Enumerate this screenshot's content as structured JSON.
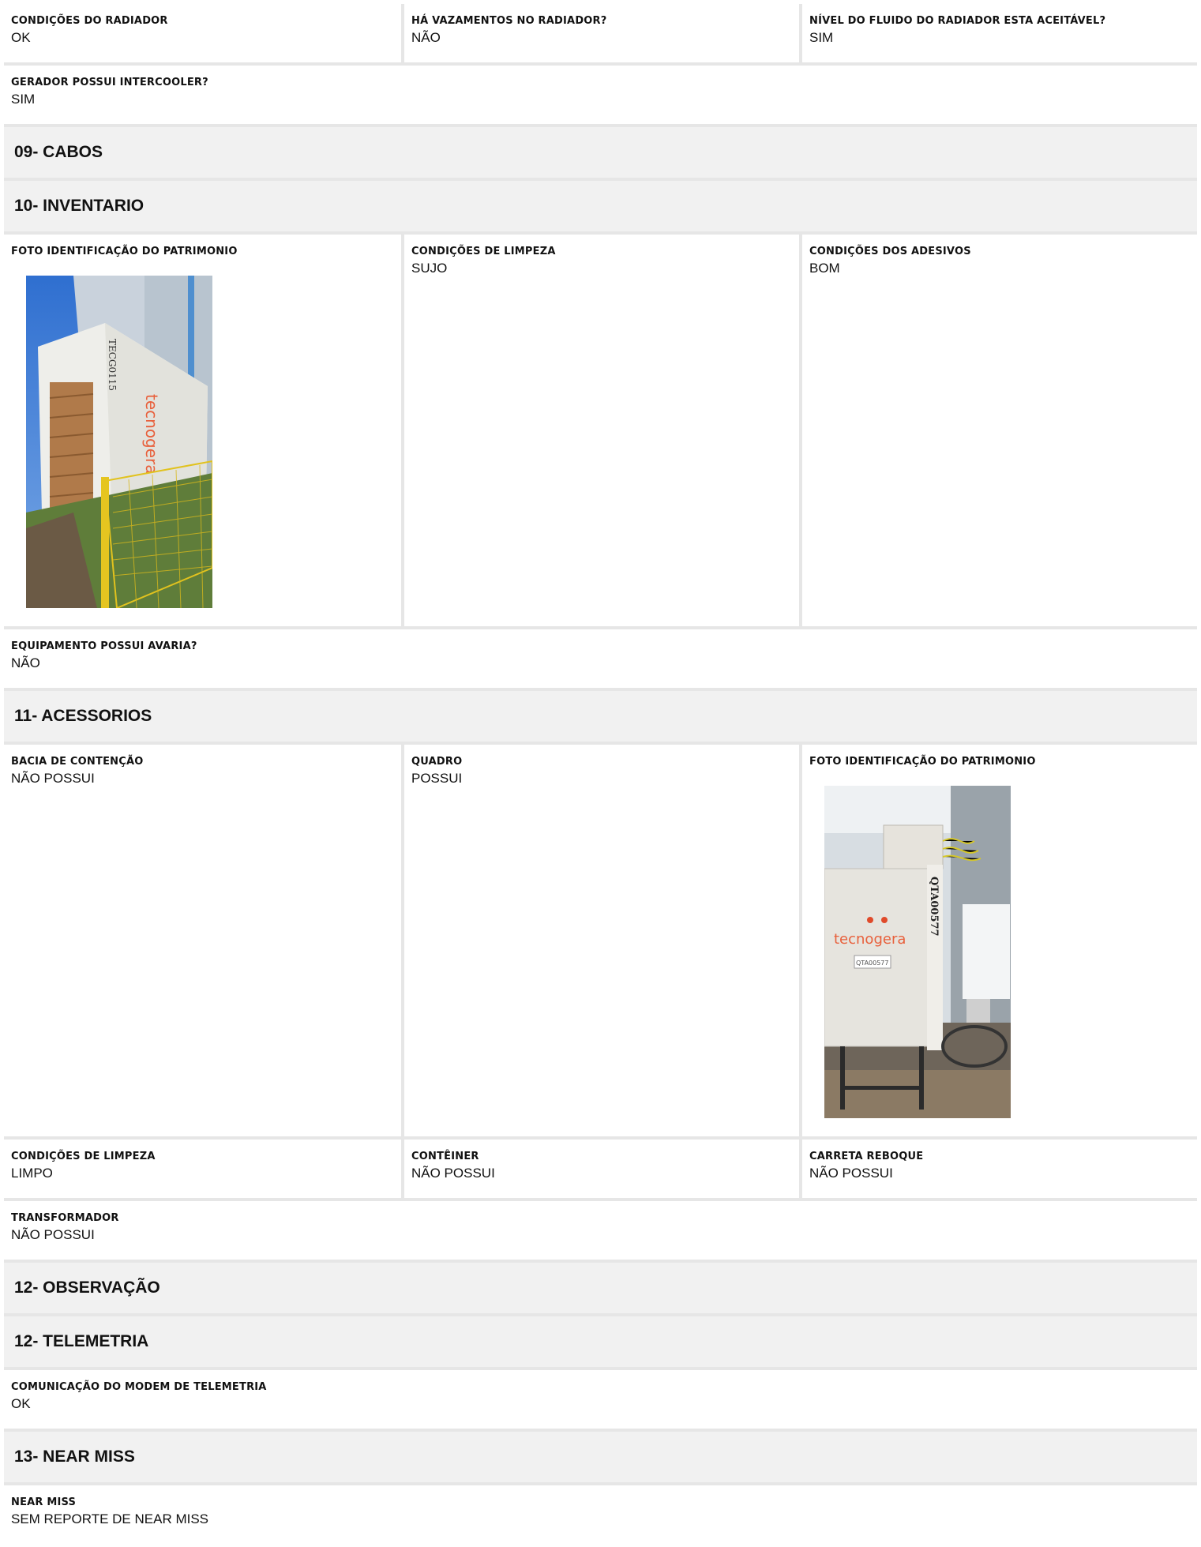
{
  "row1": [
    {
      "label": "CONDIÇÕES DO RADIADOR",
      "value": "OK"
    },
    {
      "label": "HÁ VAZAMENTOS NO RADIADOR?",
      "value": "NÃO"
    },
    {
      "label": "NÍVEL DO FLUIDO DO RADIADOR ESTA ACEITÁVEL?",
      "value": "SIM"
    }
  ],
  "intercooler": {
    "label": "GERADOR POSSUI INTERCOOLER?",
    "value": "SIM"
  },
  "sections": {
    "cabos": "09- CABOS",
    "inventario": "10- INVENTARIO",
    "acessorios": "11- ACESSORIOS",
    "observacao": "12- OBSERVAÇÃO",
    "telemetria": "12- TELEMETRIA",
    "near_miss": "13- NEAR MISS"
  },
  "inventario_row": {
    "photo_label": "FOTO IDENTIFICAÇÃO DO PATRIMONIO",
    "photo_desc": "generator-container-photo",
    "limpeza": {
      "label": "CONDIÇÕES DE LIMPEZA",
      "value": "SUJO"
    },
    "adesivos": {
      "label": "CONDIÇÕES DOS ADESIVOS",
      "value": "BOM"
    }
  },
  "avaria": {
    "label": "EQUIPAMENTO POSSUI AVARIA?",
    "value": "NÃO"
  },
  "acessorios_row": {
    "bacia": {
      "label": "BACIA DE CONTENÇÃO",
      "value": "NÃO POSSUI"
    },
    "quadro": {
      "label": "QUADRO",
      "value": "POSSUI"
    },
    "photo_label": "FOTO IDENTIFICAÇÃO DO PATRIMONIO"
  },
  "acessorios_row2": [
    {
      "label": "CONDIÇÕES DE LIMPEZA",
      "value": "LIMPO"
    },
    {
      "label": "CONTÊINER",
      "value": "NÃO POSSUI"
    },
    {
      "label": "CARRETA REBOQUE",
      "value": "NÃO POSSUI"
    }
  ],
  "transformador": {
    "label": "TRANSFORMADOR",
    "value": "NÃO POSSUI"
  },
  "telemetria_item": {
    "label": "COMUNICAÇÃO DO MODEM DE TELEMETRIA",
    "value": "OK"
  },
  "near_miss_item": {
    "label": "NEAR MISS",
    "value": "SEM REPORTE DE NEAR MISS"
  },
  "photo_text": {
    "gen_brand": "tecnogera",
    "gen_code": "TECG0115",
    "panel_brand": "tecnogera",
    "panel_code": "QTA00577",
    "panel_tag": "QTA00577"
  }
}
